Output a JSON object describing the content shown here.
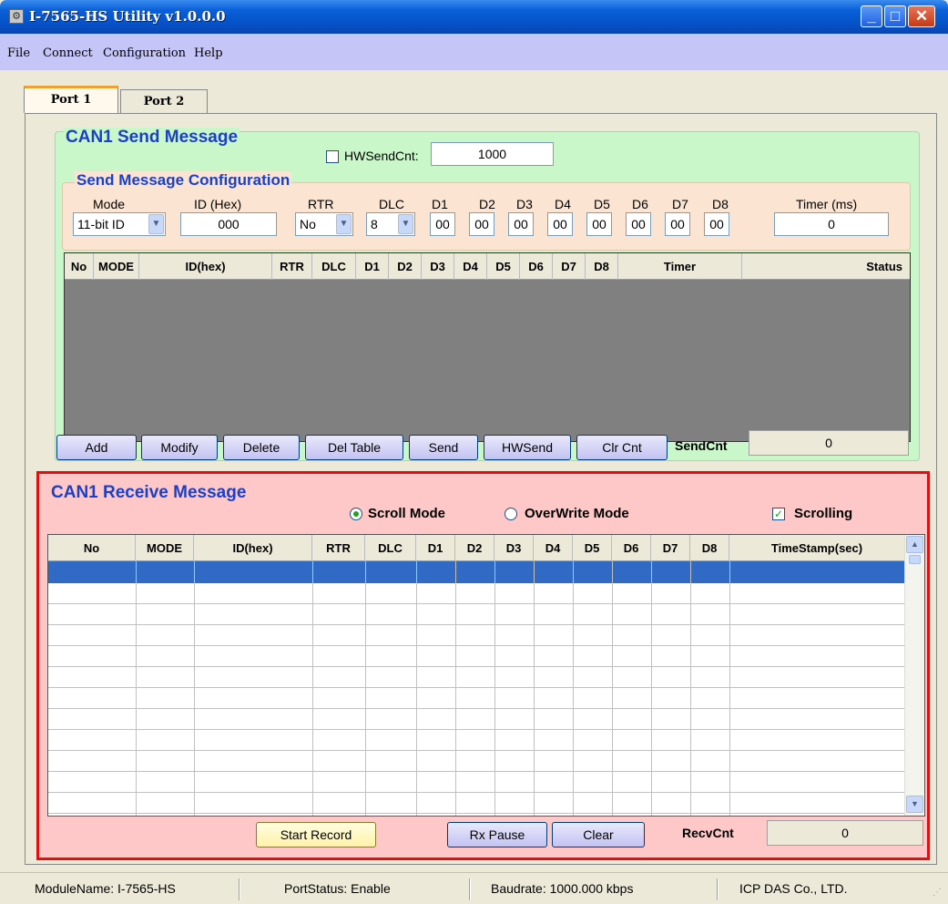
{
  "window": {
    "title": "I-7565-HS Utility v1.0.0.0"
  },
  "menu": [
    "File",
    "Connect",
    "Configuration",
    "Help"
  ],
  "tabs": [
    "Port 1",
    "Port 2"
  ],
  "send": {
    "title": "CAN1 Send Message",
    "hwsendcnt_label": "HWSendCnt:",
    "hwsendcnt_value": "1000",
    "config_title": "Send Message Configuration",
    "labels": {
      "mode": "Mode",
      "id": "ID (Hex)",
      "rtr": "RTR",
      "dlc": "DLC",
      "d1": "D1",
      "d2": "D2",
      "d3": "D3",
      "d4": "D4",
      "d5": "D5",
      "d6": "D6",
      "d7": "D7",
      "d8": "D8",
      "timer": "Timer (ms)"
    },
    "values": {
      "mode": "11-bit ID",
      "id": "000",
      "rtr": "No",
      "dlc": "8",
      "d1": "00",
      "d2": "00",
      "d3": "00",
      "d4": "00",
      "d5": "00",
      "d6": "00",
      "d7": "00",
      "d8": "00",
      "timer": "0"
    },
    "table_headers": [
      "No",
      "MODE",
      "ID(hex)",
      "RTR",
      "DLC",
      "D1",
      "D2",
      "D3",
      "D4",
      "D5",
      "D6",
      "D7",
      "D8",
      "Timer",
      "Status"
    ],
    "buttons": {
      "add": "Add",
      "modify": "Modify",
      "delete": "Delete",
      "del_table": "Del Table",
      "send": "Send",
      "hwsend": "HWSend",
      "clr_cnt": "Clr Cnt"
    },
    "sendcnt_label": "SendCnt",
    "sendcnt_value": "0"
  },
  "recv": {
    "title": "CAN1 Receive Message",
    "scroll_mode": "Scroll Mode",
    "overwrite_mode": "OverWrite Mode",
    "scrolling": "Scrolling",
    "table_headers": [
      "No",
      "MODE",
      "ID(hex)",
      "RTR",
      "DLC",
      "D1",
      "D2",
      "D3",
      "D4",
      "D5",
      "D6",
      "D7",
      "D8",
      "TimeStamp(sec)"
    ],
    "buttons": {
      "start_record": "Start Record",
      "rx_pause": "Rx Pause",
      "clear": "Clear"
    },
    "recvcnt_label": "RecvCnt",
    "recvcnt_value": "0"
  },
  "status": {
    "module": "ModuleName: I-7565-HS",
    "port": "PortStatus: Enable",
    "baud": "Baudrate: 1000.000 kbps",
    "company": "ICP DAS Co., LTD."
  }
}
